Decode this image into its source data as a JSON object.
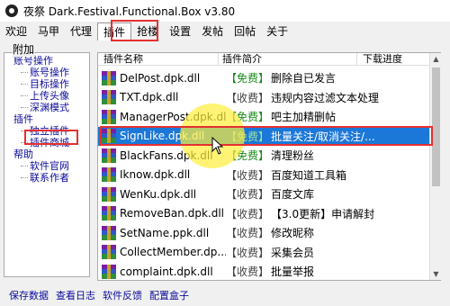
{
  "window": {
    "title": "夜祭 Dark.Festival.Functional.Box v3.80"
  },
  "menu": {
    "items": [
      {
        "label": "欢迎"
      },
      {
        "label": "马甲"
      },
      {
        "label": "代理"
      },
      {
        "label": "插件"
      },
      {
        "label": "抢楼"
      },
      {
        "label": "设置"
      },
      {
        "label": "发帖"
      },
      {
        "label": "回帖"
      },
      {
        "label": "关于"
      }
    ],
    "active_index": 3
  },
  "left_panel": {
    "header": "附加",
    "items": [
      {
        "label": "账号操作",
        "level": 0
      },
      {
        "label": "账号操作",
        "level": 1
      },
      {
        "label": "目标操作",
        "level": 1
      },
      {
        "label": "上传头像",
        "level": 1
      },
      {
        "label": "深渊模式",
        "level": 1
      },
      {
        "label": "插件",
        "level": 0
      },
      {
        "label": "独立插件",
        "level": 1
      },
      {
        "label": "插件商城",
        "level": 1
      },
      {
        "label": "帮助",
        "level": 0
      },
      {
        "label": "软件官网",
        "level": 1
      },
      {
        "label": "联系作者",
        "level": 1
      }
    ]
  },
  "plugin_list": {
    "columns": {
      "name": "插件名称",
      "desc": "插件简介",
      "progress": "下载进度"
    },
    "rows": [
      {
        "name": "DelPost.dpk.dll",
        "tag": "【免费】",
        "desc": "删除自已发言"
      },
      {
        "name": "TXT.dpk.dll",
        "tag": "【收费】",
        "desc": "违规内容过滤文本处理"
      },
      {
        "name": "ManagerPost.dpk.dll",
        "tag": "【免费】",
        "desc": "吧主加精删帖"
      },
      {
        "name": "SignLike.dpk.dll",
        "tag": "【免费】",
        "desc": "批量关注/取消关注/..."
      },
      {
        "name": "BlackFans.dpk.dll",
        "tag": "【免费】",
        "desc": "清理粉丝"
      },
      {
        "name": "Iknow.dpk.dll",
        "tag": "【收费】",
        "desc": "百度知道工具箱"
      },
      {
        "name": "WenKu.dpk.dll",
        "tag": "【收费】",
        "desc": "百度文库"
      },
      {
        "name": "RemoveBan.dpk.dll",
        "tag": "【收费】",
        "desc": "【3.0更新】申请解封"
      },
      {
        "name": "SetName.ppk.dll",
        "tag": "【收费】",
        "desc": "修改昵称"
      },
      {
        "name": "CollectMember.dp...",
        "tag": "【收费】",
        "desc": "采集会员"
      },
      {
        "name": "complaint.dpk.dll",
        "tag": "【收费】",
        "desc": "批量举报"
      }
    ],
    "selected_index": 3
  },
  "bottom_links": [
    {
      "label": "保存数据"
    },
    {
      "label": "查看日志"
    },
    {
      "label": "软件反馈"
    },
    {
      "label": "配置盒子"
    }
  ]
}
